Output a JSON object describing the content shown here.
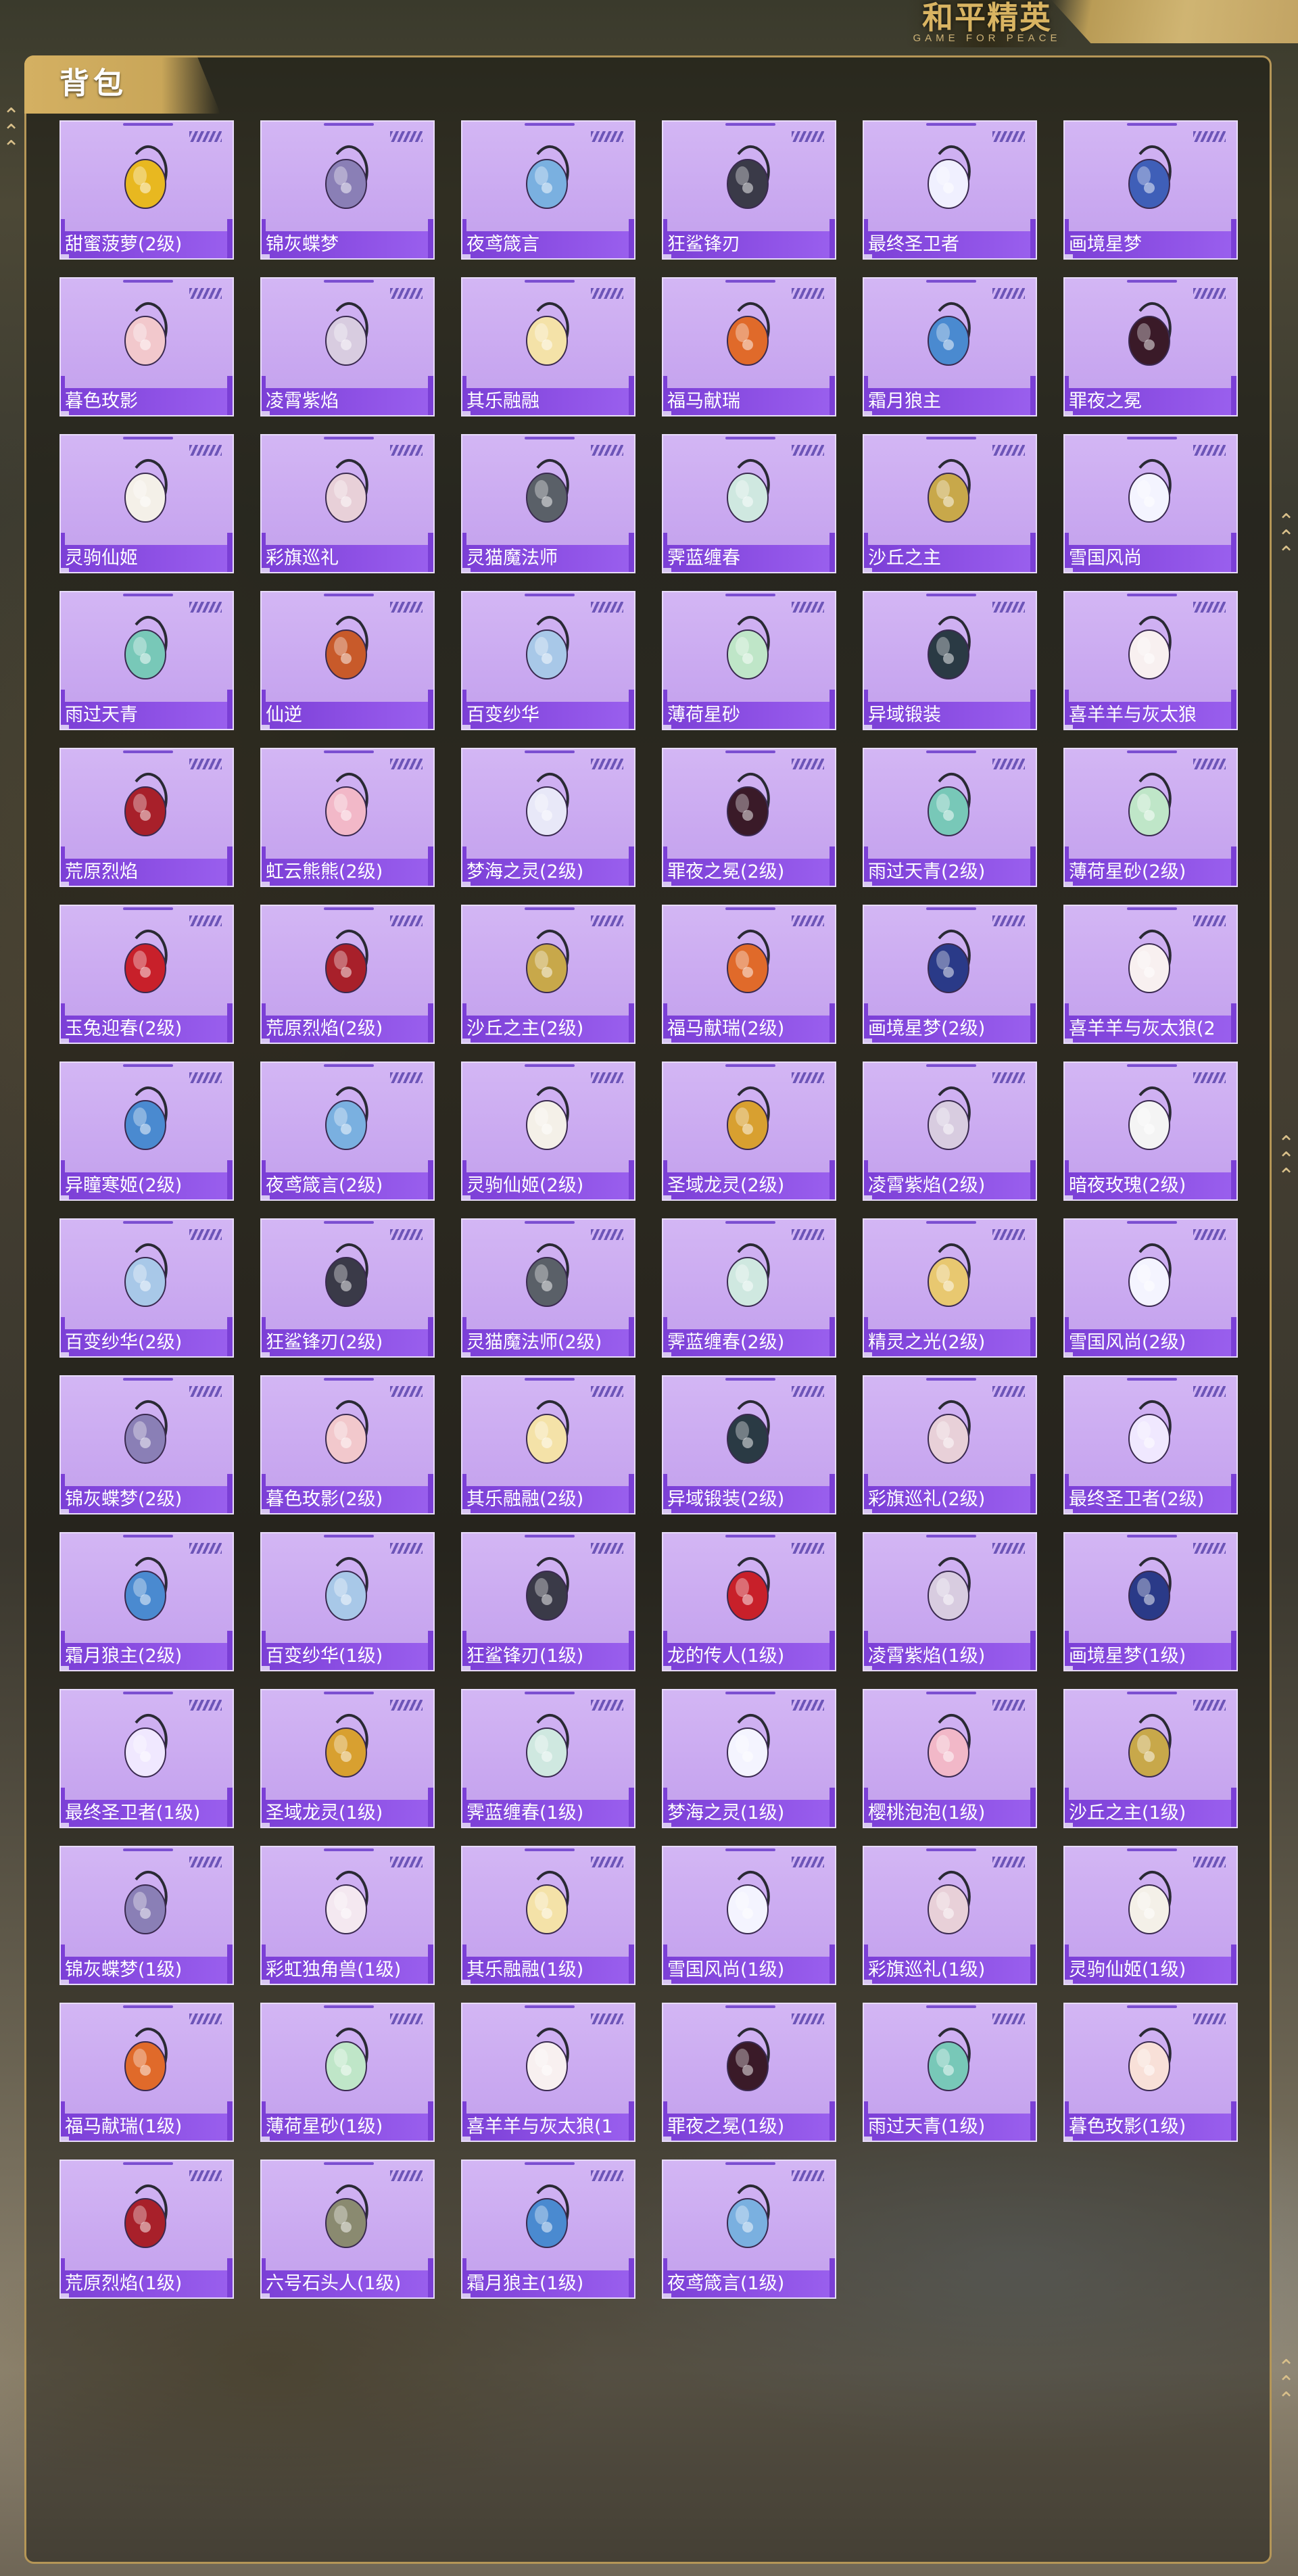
{
  "header": {
    "logo_title": "和平精英",
    "logo_subtitle": "GAME FOR PEACE"
  },
  "section": {
    "title": "背包"
  },
  "items": [
    {
      "name": "甜蜜菠萝(2级)",
      "icon": "pineapple-backpack-icon",
      "accent": "#e8b820"
    },
    {
      "name": "锦灰蝶梦",
      "icon": "butterfly-backpack-icon",
      "accent": "#8a7fb6"
    },
    {
      "name": "夜鸢箴言",
      "icon": "blue-kite-backpack-icon",
      "accent": "#7ab0e0"
    },
    {
      "name": "狂鲨锋刃",
      "icon": "shark-backpack-icon",
      "accent": "#3a3a48"
    },
    {
      "name": "最终圣卫者",
      "icon": "winged-guardian-backpack-icon",
      "accent": "#f0f0ff"
    },
    {
      "name": "画境星梦",
      "icon": "storybook-backpack-icon",
      "accent": "#3f5fb8"
    },
    {
      "name": "暮色玫影",
      "icon": "rose-doll-backpack-icon",
      "accent": "#f2c8cc"
    },
    {
      "name": "凌霄紫焰",
      "icon": "lantern-backpack-icon",
      "accent": "#d8cce0"
    },
    {
      "name": "其乐融融",
      "icon": "icecream-bunny-backpack-icon",
      "accent": "#f4e2a8"
    },
    {
      "name": "福马献瑞",
      "icon": "orange-horse-backpack-icon",
      "accent": "#e06a2a"
    },
    {
      "name": "霜月狼主",
      "icon": "moon-wolf-backpack-icon",
      "accent": "#4a8ad0"
    },
    {
      "name": "罪夜之冕",
      "icon": "dark-skull-backpack-icon",
      "accent": "#3a1a28"
    },
    {
      "name": "灵驹仙姬",
      "icon": "pearl-pendant-backpack-icon",
      "accent": "#f4f0e8"
    },
    {
      "name": "彩旗巡礼",
      "icon": "parade-bunny-backpack-icon",
      "accent": "#e8d0d8"
    },
    {
      "name": "灵猫魔法师",
      "icon": "magic-cat-backpack-icon",
      "accent": "#5a6068"
    },
    {
      "name": "霁蓝缠春",
      "icon": "jade-pumpkin-backpack-icon",
      "accent": "#cfe8e0"
    },
    {
      "name": "沙丘之主",
      "icon": "desert-scroll-backpack-icon",
      "accent": "#c8a84a"
    },
    {
      "name": "雪国风尚",
      "icon": "snow-blob-backpack-icon",
      "accent": "#f4f4ff"
    },
    {
      "name": "雨过天青",
      "icon": "celadon-backpack-icon",
      "accent": "#78c8b8"
    },
    {
      "name": "仙逆",
      "icon": "phoenix-backpack-icon",
      "accent": "#c85a2a"
    },
    {
      "name": "百变纱华",
      "icon": "lace-crystal-backpack-icon",
      "accent": "#a8c8e8"
    },
    {
      "name": "薄荷星砂",
      "icon": "mint-backpack-icon",
      "accent": "#bfe6c8"
    },
    {
      "name": "异域锻装",
      "icon": "tactical-backpack-icon",
      "accent": "#2a3a44"
    },
    {
      "name": "喜羊羊与灰太狼",
      "icon": "sheep-backpack-icon",
      "accent": "#f8f0f0"
    },
    {
      "name": "荒原烈焰",
      "icon": "flame-backpack-icon",
      "accent": "#a8202a"
    },
    {
      "name": "虹云熊熊(2级)",
      "icon": "cloud-bear-backpack-icon",
      "accent": "#f2b8c8"
    },
    {
      "name": "梦海之灵(2级)",
      "icon": "dream-shell-backpack-icon",
      "accent": "#e8e8f8"
    },
    {
      "name": "罪夜之冕(2级)",
      "icon": "dark-skull-backpack-icon",
      "accent": "#3a1a28"
    },
    {
      "name": "雨过天青(2级)",
      "icon": "celadon-backpack-icon",
      "accent": "#78c8b8"
    },
    {
      "name": "薄荷星砂(2级)",
      "icon": "mint-backpack-icon",
      "accent": "#bfe6c8"
    },
    {
      "name": "玉兔迎春(2级)",
      "icon": "red-bunny-backpack-icon",
      "accent": "#c8202a"
    },
    {
      "name": "荒原烈焰(2级)",
      "icon": "flame-backpack-icon",
      "accent": "#a8202a"
    },
    {
      "name": "沙丘之主(2级)",
      "icon": "desert-scroll-backpack-icon",
      "accent": "#c8a84a"
    },
    {
      "name": "福马献瑞(2级)",
      "icon": "orange-horse-backpack-icon",
      "accent": "#e06a2a"
    },
    {
      "name": "画境星梦(2级)",
      "icon": "storybook-backpack-icon",
      "accent": "#2a3a88"
    },
    {
      "name": "喜羊羊与灰太狼(2",
      "icon": "sheep-backpack-icon",
      "accent": "#f8f0f0"
    },
    {
      "name": "异瞳寒姬(2级)",
      "icon": "ice-princess-backpack-icon",
      "accent": "#4a8ad0"
    },
    {
      "name": "夜鸢箴言(2级)",
      "icon": "blue-kite-backpack-icon",
      "accent": "#7ab0e0"
    },
    {
      "name": "灵驹仙姬(2级)",
      "icon": "pearl-pendant-backpack-icon",
      "accent": "#f4f0e8"
    },
    {
      "name": "圣域龙灵(2级)",
      "icon": "gold-dragon-backpack-icon",
      "accent": "#d8a030"
    },
    {
      "name": "凌霄紫焰(2级)",
      "icon": "lantern-backpack-icon",
      "accent": "#d8cce0"
    },
    {
      "name": "暗夜玫瑰(2级)",
      "icon": "rose-bunny-backpack-icon",
      "accent": "#f4f4f4"
    },
    {
      "name": "百变纱华(2级)",
      "icon": "lace-crystal-backpack-icon",
      "accent": "#a8c8e8"
    },
    {
      "name": "狂鲨锋刃(2级)",
      "icon": "shark-backpack-icon",
      "accent": "#3a3a48"
    },
    {
      "name": "灵猫魔法师(2级)",
      "icon": "magic-cat-backpack-icon",
      "accent": "#5a6068"
    },
    {
      "name": "霁蓝缠春(2级)",
      "icon": "jade-pumpkin-backpack-icon",
      "accent": "#cfe8e0"
    },
    {
      "name": "精灵之光(2级)",
      "icon": "fairy-light-backpack-icon",
      "accent": "#e8c870"
    },
    {
      "name": "雪国风尚(2级)",
      "icon": "snow-blob-backpack-icon",
      "accent": "#f4f4ff"
    },
    {
      "name": "锦灰蝶梦(2级)",
      "icon": "butterfly-backpack-icon",
      "accent": "#8a7fb6"
    },
    {
      "name": "暮色玫影(2级)",
      "icon": "rose-doll-backpack-icon",
      "accent": "#f2c8cc"
    },
    {
      "name": "其乐融融(2级)",
      "icon": "icecream-bunny-backpack-icon",
      "accent": "#f4e2a8"
    },
    {
      "name": "异域锻装(2级)",
      "icon": "tactical-backpack-icon",
      "accent": "#2a3a44"
    },
    {
      "name": "彩旗巡礼(2级)",
      "icon": "parade-bunny-backpack-icon",
      "accent": "#e8d0d8"
    },
    {
      "name": "最终圣卫者(2级)",
      "icon": "winged-guardian-backpack-icon",
      "accent": "#f0e8ff"
    },
    {
      "name": "霜月狼主(2级)",
      "icon": "moon-wolf-backpack-icon",
      "accent": "#4a8ad0"
    },
    {
      "name": "百变纱华(1级)",
      "icon": "lace-crystal-backpack-icon",
      "accent": "#a8c8e8"
    },
    {
      "name": "狂鲨锋刃(1级)",
      "icon": "shark-backpack-icon",
      "accent": "#3a3a48"
    },
    {
      "name": "龙的传人(1级)",
      "icon": "dragon-heir-backpack-icon",
      "accent": "#c8202a"
    },
    {
      "name": "凌霄紫焰(1级)",
      "icon": "lantern-backpack-icon",
      "accent": "#d8cce0"
    },
    {
      "name": "画境星梦(1级)",
      "icon": "storybook-backpack-icon",
      "accent": "#2a3a88"
    },
    {
      "name": "最终圣卫者(1级)",
      "icon": "winged-guardian-backpack-icon",
      "accent": "#f0e8ff"
    },
    {
      "name": "圣域龙灵(1级)",
      "icon": "gold-dragon-backpack-icon",
      "accent": "#d8a030"
    },
    {
      "name": "霁蓝缠春(1级)",
      "icon": "jade-pumpkin-backpack-icon",
      "accent": "#cfe8e0"
    },
    {
      "name": "梦海之灵(1级)",
      "icon": "dream-shell-backpack-icon",
      "accent": "#f4f4ff"
    },
    {
      "name": "樱桃泡泡(1级)",
      "icon": "cherry-bubble-backpack-icon",
      "accent": "#f2b8c8"
    },
    {
      "name": "沙丘之主(1级)",
      "icon": "desert-scroll-backpack-icon",
      "accent": "#c8a84a"
    },
    {
      "name": "锦灰蝶梦(1级)",
      "icon": "butterfly-backpack-icon",
      "accent": "#8a7fb6"
    },
    {
      "name": "彩虹独角兽(1级)",
      "icon": "unicorn-backpack-icon",
      "accent": "#f4e8f0"
    },
    {
      "name": "其乐融融(1级)",
      "icon": "icecream-bunny-backpack-icon",
      "accent": "#f4e2a8"
    },
    {
      "name": "雪国风尚(1级)",
      "icon": "snow-blob-backpack-icon",
      "accent": "#f4f4ff"
    },
    {
      "name": "彩旗巡礼(1级)",
      "icon": "parade-bunny-backpack-icon",
      "accent": "#e8d0d8"
    },
    {
      "name": "灵驹仙姬(1级)",
      "icon": "pearl-pendant-backpack-icon",
      "accent": "#f4f0e8"
    },
    {
      "name": "福马献瑞(1级)",
      "icon": "orange-horse-backpack-icon",
      "accent": "#e06a2a"
    },
    {
      "name": "薄荷星砂(1级)",
      "icon": "mint-backpack-icon",
      "accent": "#bfe6c8"
    },
    {
      "name": "喜羊羊与灰太狼(1",
      "icon": "sheep-backpack-icon",
      "accent": "#f8f0f0"
    },
    {
      "name": "罪夜之冕(1级)",
      "icon": "dark-skull-backpack-icon",
      "accent": "#3a1a28"
    },
    {
      "name": "雨过天青(1级)",
      "icon": "celadon-backpack-icon",
      "accent": "#78c8b8"
    },
    {
      "name": "暮色玫影(1级)",
      "icon": "bat-doll-backpack-icon",
      "accent": "#f8e0d8"
    },
    {
      "name": "荒原烈焰(1级)",
      "icon": "flame-backpack-icon",
      "accent": "#a8202a"
    },
    {
      "name": "六号石头人(1级)",
      "icon": "stone-golem-backpack-icon",
      "accent": "#8a8a70"
    },
    {
      "name": "霜月狼主(1级)",
      "icon": "moon-wolf-backpack-icon",
      "accent": "#4a8ad0"
    },
    {
      "name": "夜鸢箴言(1级)",
      "icon": "blue-kite-backpack-icon",
      "accent": "#7ab0e0"
    }
  ]
}
